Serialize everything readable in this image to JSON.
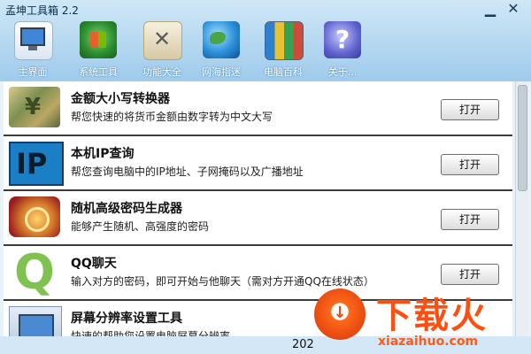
{
  "app": {
    "title": "孟坤工具箱 2.2",
    "minimize_glyph": "▁",
    "close_glyph": "✕"
  },
  "toolbar": {
    "items": [
      {
        "label": "主界面",
        "icon": "monitor-icon"
      },
      {
        "label": "系统工具",
        "icon": "windows-logo-icon"
      },
      {
        "label": "功能大全",
        "icon": "tools-icon"
      },
      {
        "label": "网海指迷",
        "icon": "globe-icon"
      },
      {
        "label": "电脑百科",
        "icon": "books-icon"
      },
      {
        "label": "关于...",
        "icon": "help-icon"
      }
    ]
  },
  "tools": [
    {
      "name": "金额大小写转换器",
      "desc": "帮您快速的将货币金额由数字转为中文大写",
      "button": "打开",
      "icon": "money-icon"
    },
    {
      "name": "本机IP查询",
      "desc": "帮您查询电脑中的IP地址、子网掩码以及广播地址",
      "button": "打开",
      "icon": "ip-icon"
    },
    {
      "name": "随机高级密码生成器",
      "desc": "能够产生随机、高强度的密码",
      "button": "打开",
      "icon": "lock-icon"
    },
    {
      "name": "QQ聊天",
      "desc": "输入对方的密码，即可开始与他聊天（需对方开通QQ在线状态）",
      "button": "打开",
      "icon": "qq-icon"
    },
    {
      "name": "屏幕分辨率设置工具",
      "desc": "快速的帮助您设置电脑屏幕分辨率",
      "button": "",
      "icon": "screen-icon"
    }
  ],
  "status": {
    "text": "202"
  },
  "watermark": {
    "title": "下载火",
    "url": "xiazaihuo.com"
  },
  "colors": {
    "accent": "#ff4f10",
    "toolbar_bg": "#9fcbec"
  }
}
